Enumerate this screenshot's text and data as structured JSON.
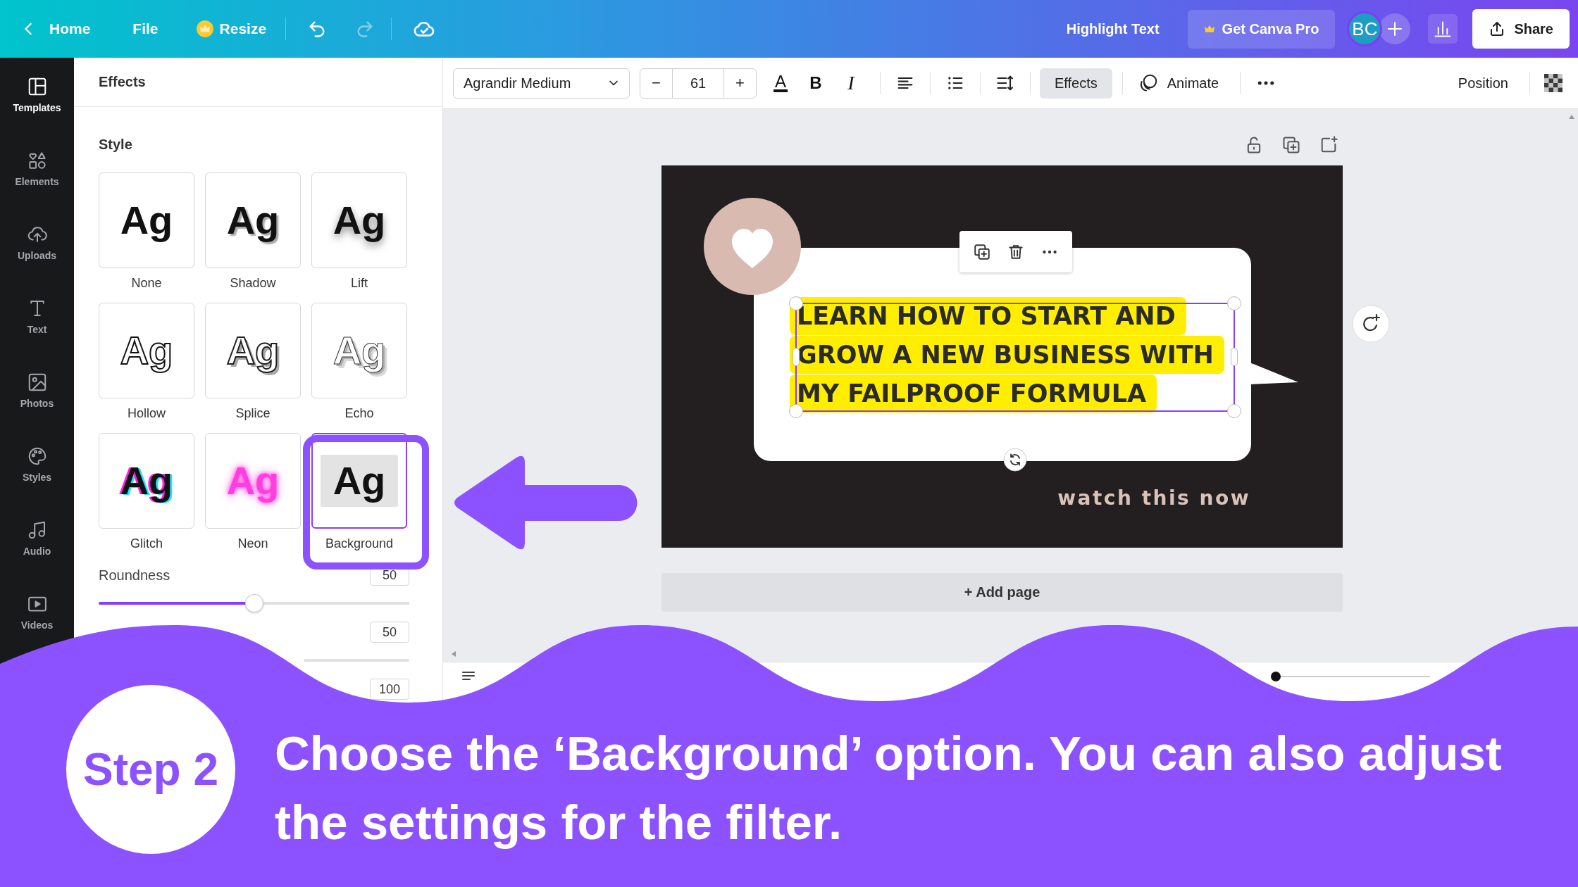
{
  "topbar": {
    "nav": [
      {
        "kind": "home",
        "label": "Home"
      },
      {
        "kind": "file",
        "label": "File"
      },
      {
        "kind": "resize",
        "label": "Resize"
      }
    ],
    "history": [
      {
        "kind": "undo",
        "disabled": false
      },
      {
        "kind": "redo",
        "disabled": true
      }
    ],
    "title": "Highlight Text",
    "pro_button": "Get Canva Pro",
    "avatar": "BC",
    "share_button": "Share"
  },
  "sidebar": {
    "items": [
      {
        "kind": "templates",
        "label": "Templates",
        "selected": true
      },
      {
        "kind": "elements",
        "label": "Elements",
        "selected": false
      },
      {
        "kind": "uploads",
        "label": "Uploads",
        "selected": false
      },
      {
        "kind": "text",
        "label": "Text",
        "selected": false
      },
      {
        "kind": "photos",
        "label": "Photos",
        "selected": false
      },
      {
        "kind": "styles",
        "label": "Styles",
        "selected": false
      },
      {
        "kind": "audio",
        "label": "Audio",
        "selected": false
      },
      {
        "kind": "videos",
        "label": "Videos",
        "selected": false
      }
    ]
  },
  "panel": {
    "title": "Effects",
    "section": "Style",
    "styles": [
      {
        "kind": "none",
        "preview": "Ag",
        "label": "None",
        "selected": false
      },
      {
        "kind": "shadow",
        "preview": "Ag",
        "label": "Shadow",
        "selected": false
      },
      {
        "kind": "lift",
        "preview": "Ag",
        "label": "Lift",
        "selected": false
      },
      {
        "kind": "hollow",
        "preview": "Ag",
        "label": "Hollow",
        "selected": false
      },
      {
        "kind": "splice",
        "preview": "Ag",
        "label": "Splice",
        "selected": false
      },
      {
        "kind": "echo",
        "preview": "Ag",
        "label": "Echo",
        "selected": false
      },
      {
        "kind": "glitch",
        "preview": "Ag",
        "label": "Glitch",
        "selected": false
      },
      {
        "kind": "neon",
        "preview": "Ag",
        "label": "Neon",
        "selected": false
      },
      {
        "kind": "background",
        "preview": "Ag",
        "label": "Background",
        "selected": true
      }
    ],
    "controls": [
      {
        "kind": "slider",
        "label": "Roundness",
        "value": "50",
        "level": 0.5
      },
      {
        "kind": "track",
        "value": "50"
      },
      {
        "kind": "value",
        "value": "100"
      }
    ]
  },
  "toolbar": {
    "font": "Agrandir Medium",
    "size": {
      "decrease": "−",
      "value": "61",
      "increase": "+"
    },
    "format": [
      {
        "kind": "text-color",
        "glyph": "A"
      },
      {
        "kind": "bold",
        "glyph": "B"
      },
      {
        "kind": "italic",
        "glyph": "I"
      },
      {
        "kind": "align"
      },
      {
        "kind": "list"
      },
      {
        "kind": "spacing"
      }
    ],
    "effects": {
      "label": "Effects",
      "selected": true
    },
    "animate": "Animate",
    "position": "Position"
  },
  "canvas": {
    "headline": "LEARN HOW TO START AND GROW A NEW BUSINESS WITH MY FAILPROOF FORMULA",
    "tagline": "watch this now",
    "add_page": "+ Add page"
  },
  "tutorial": {
    "step": "Step 2",
    "caption": "Choose the ‘Background’ option. You can also adjust the settings for the filter."
  }
}
